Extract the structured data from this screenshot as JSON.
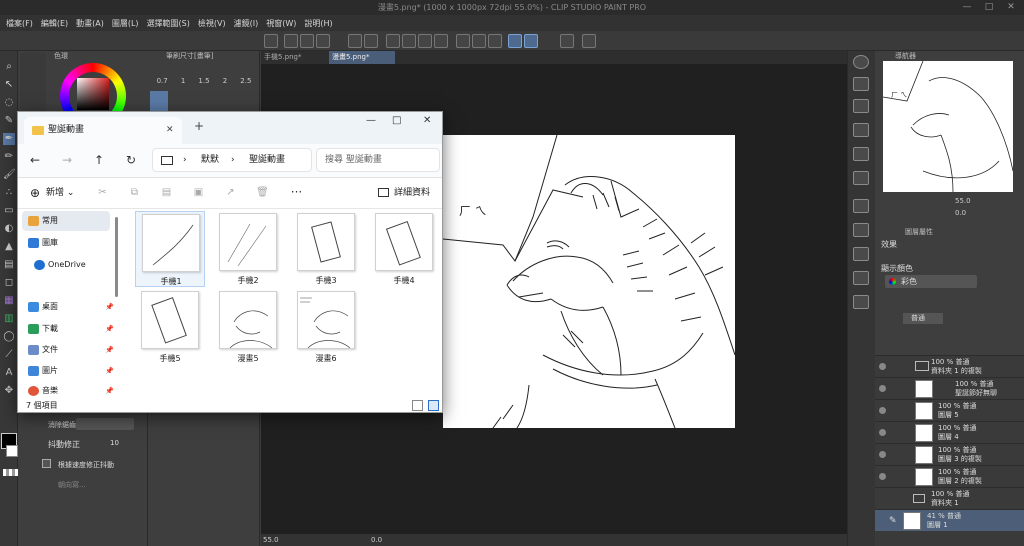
{
  "app": {
    "title": "漫畫5.png* (1000 x 1000px 72dpi 55.0%)  - CLIP STUDIO PAINT PRO"
  },
  "menu": [
    "檔案(F)",
    "編輯(E)",
    "動畫(A)",
    "圖層(L)",
    "選擇範圍(S)",
    "檢視(V)",
    "濾鏡(I)",
    "視窗(W)",
    "說明(H)"
  ],
  "canvas_tabs": [
    "手機5.png*",
    "漫畫5.png*"
  ],
  "left_panel": {
    "color_tab": "色環",
    "brush_tab": "筆刷尺寸[畫筆]",
    "brush_sizes_row1": [
      "0.7",
      "1",
      "1.5",
      "2",
      "2.5"
    ],
    "stabilize_label": "抖動修正",
    "stabilize_value": "10",
    "speed_label": "根據速度修正抖動",
    "blend_label": "消除鋸齒",
    "vector_label": "朝向寫..."
  },
  "status": {
    "zoom": "55.0",
    "angle": "0.0"
  },
  "right_panel": {
    "navigator_tab": "導航器",
    "zoom_value": "55.0",
    "rotate_value": "0.0",
    "layer_props_tab": "圖層屬性",
    "effect_label": "效果",
    "display_color_label": "顯示顏色",
    "display_color_value": "彩色",
    "blend_mode": "普通",
    "layers": [
      {
        "opacity": "100 % 普通",
        "name": "資料夾 1 的複製",
        "type": "folder"
      },
      {
        "opacity": "100 % 普通",
        "name": "聖誕節好無聊",
        "type": "text"
      },
      {
        "opacity": "100 % 普通",
        "name": "圖層 5",
        "type": "raster"
      },
      {
        "opacity": "100 % 普通",
        "name": "圖層 4",
        "type": "raster"
      },
      {
        "opacity": "100 % 普通",
        "name": "圖層 3 的複製",
        "type": "raster"
      },
      {
        "opacity": "100 % 普通",
        "name": "圖層 2 的複製",
        "type": "raster"
      },
      {
        "opacity": "100 % 普通",
        "name": "資料夾 1",
        "type": "folder"
      },
      {
        "opacity": "41 % 普通",
        "name": "圖層 1",
        "type": "raster"
      }
    ]
  },
  "explorer": {
    "tab_title": "聖誕動畫",
    "path_root": "默默",
    "path_current": "聖誕動畫",
    "search_placeholder": "搜尋 聖誕動畫",
    "new_label": "新增",
    "details_label": "詳細資料",
    "sidebar": [
      {
        "label": "常用",
        "icon": "home-icon",
        "color": "#e8a33d"
      },
      {
        "label": "圖庫",
        "icon": "gallery-icon",
        "color": "#2f7ad6"
      },
      {
        "label": "OneDrive",
        "icon": "cloud-icon",
        "color": "#1f6fd1"
      },
      {
        "label": "桌面",
        "icon": "desktop-icon",
        "color": "#3a8be0"
      },
      {
        "label": "下載",
        "icon": "download-icon",
        "color": "#2a9d5b"
      },
      {
        "label": "文件",
        "icon": "document-icon",
        "color": "#6b8cc7"
      },
      {
        "label": "圖片",
        "icon": "picture-icon",
        "color": "#3f86d8"
      },
      {
        "label": "音樂",
        "icon": "music-icon",
        "color": "#e0553a"
      }
    ],
    "files": [
      "手機1",
      "手機2",
      "手機3",
      "手機4",
      "手機5",
      "漫畫5",
      "漫畫6"
    ],
    "item_count": "7 個項目"
  },
  "canvas_text": {
    "bubble": "ㄏ  ㄟ"
  }
}
